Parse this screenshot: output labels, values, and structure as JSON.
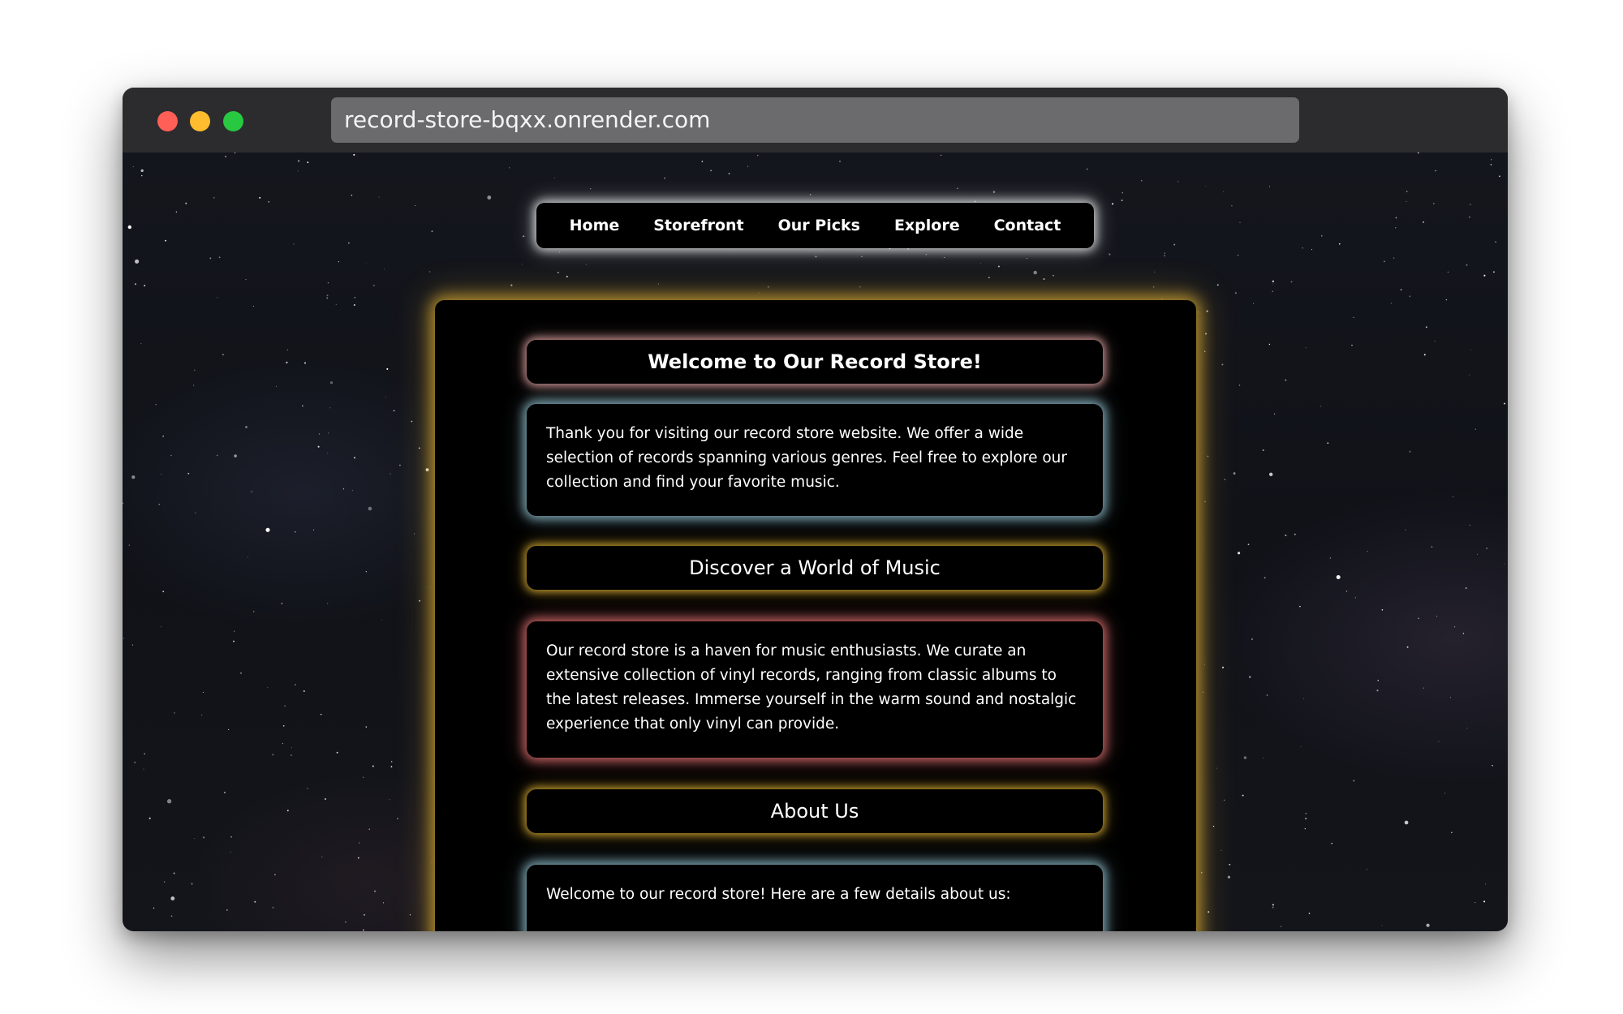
{
  "browser": {
    "url": "record-store-bqxx.onrender.com"
  },
  "nav": {
    "items": [
      {
        "label": "Home"
      },
      {
        "label": "Storefront"
      },
      {
        "label": "Our Picks"
      },
      {
        "label": "Explore"
      },
      {
        "label": "Contact"
      }
    ]
  },
  "main": {
    "welcome_heading": "Welcome to Our Record Store!",
    "intro_text": "Thank you for visiting our record store website. We offer a wide selection of records spanning various genres. Feel free to explore our collection and find your favorite music.",
    "discover_heading": "Discover a World of Music",
    "discover_text": "Our record store is a haven for music enthusiasts. We curate an extensive collection of vinyl records, ranging from classic albums to the latest releases. Immerse yourself in the warm sound and nostalgic experience that only vinyl can provide.",
    "about_heading": "About Us",
    "about_text": "Welcome to our record store! Here are a few details about us:"
  },
  "colors": {
    "panel_glow": "#d6aa32",
    "nav_glow": "#ffffff",
    "welcome_glow": "#ebaaaa",
    "intro_glow": "#96c8d7",
    "haven_glow": "#dc6e6e",
    "heading_glow": "#d6aa32",
    "background": "#12141a"
  }
}
